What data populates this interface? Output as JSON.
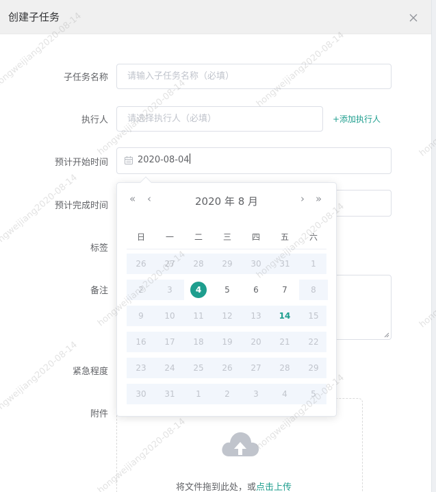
{
  "dialog": {
    "title": "创建子任务"
  },
  "form": {
    "name_label": "子任务名称",
    "name_placeholder": "请输入子任务名称（必填）",
    "executor_label": "执行人",
    "executor_placeholder": "请选择执行人（必填）",
    "add_executor": "+添加执行人",
    "start_label": "预计开始时间",
    "start_value": "2020-08-04",
    "end_label": "预计完成时间",
    "tags_label": "标签",
    "remark_label": "备注",
    "urgency_label": "紧急程度",
    "attachment_label": "附件",
    "upload_text": "将文件拖到此处，或",
    "upload_link": "点击上传"
  },
  "datepicker": {
    "title": "2020 年  8 月",
    "prev_year": "«",
    "prev_month": "‹",
    "next_month": "›",
    "next_year": "»",
    "weekdays": [
      "日",
      "一",
      "二",
      "三",
      "四",
      "五",
      "六"
    ],
    "weeks": [
      [
        "26",
        "27",
        "28",
        "29",
        "30",
        "31",
        "1"
      ],
      [
        "2",
        "3",
        "4",
        "5",
        "6",
        "7",
        "8"
      ],
      [
        "9",
        "10",
        "11",
        "12",
        "13",
        "14",
        "15"
      ],
      [
        "16",
        "17",
        "18",
        "19",
        "20",
        "21",
        "22"
      ],
      [
        "23",
        "24",
        "25",
        "26",
        "27",
        "28",
        "29"
      ],
      [
        "30",
        "31",
        "1",
        "2",
        "3",
        "4",
        "5"
      ]
    ],
    "selected": "4",
    "today": "14"
  },
  "watermark": "hongweijiang2020-08-14",
  "colors": {
    "accent": "#1e9e8e",
    "muted": "#c0c4cc"
  }
}
